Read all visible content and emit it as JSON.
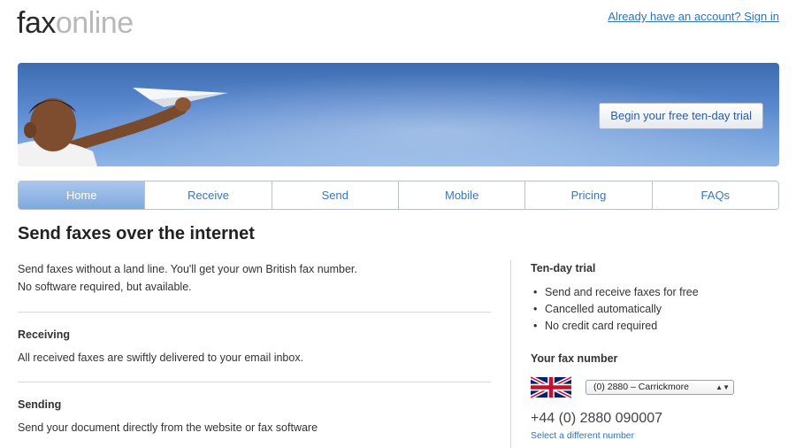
{
  "header": {
    "logo_part1": "fax",
    "logo_part2": "online",
    "signin_link": "Already have an account? Sign in"
  },
  "banner": {
    "cta_label": "Begin your free ten-day trial"
  },
  "nav": {
    "items": [
      {
        "label": "Home",
        "active": true
      },
      {
        "label": "Receive"
      },
      {
        "label": "Send"
      },
      {
        "label": "Mobile"
      },
      {
        "label": "Pricing"
      },
      {
        "label": "FAQs"
      }
    ]
  },
  "main": {
    "title": "Send faxes over the internet",
    "intro_line1": "Send faxes without a land line. You'll get your own British fax number.",
    "intro_line2": "No software required, but available.",
    "receiving_title": "Receiving",
    "receiving_text": "All received faxes are swiftly delivered to your email inbox.",
    "sending_title": "Sending",
    "sending_text": "Send your document directly from the website or fax software"
  },
  "sidebar": {
    "trial_title": "Ten-day trial",
    "trial_points": [
      "Send and receive faxes for free",
      "Cancelled automatically",
      "No credit card required"
    ],
    "fax_title": "Your fax number",
    "area_select_value": "(0) 2880 – Carrickmore",
    "fax_number": "+44 (0) 2880 090007",
    "different_number_link": "Select a different number"
  },
  "colors": {
    "link": "#2f74b5",
    "nav_active": "#7ea8dc",
    "banner_sky": "#5b8ad0"
  }
}
